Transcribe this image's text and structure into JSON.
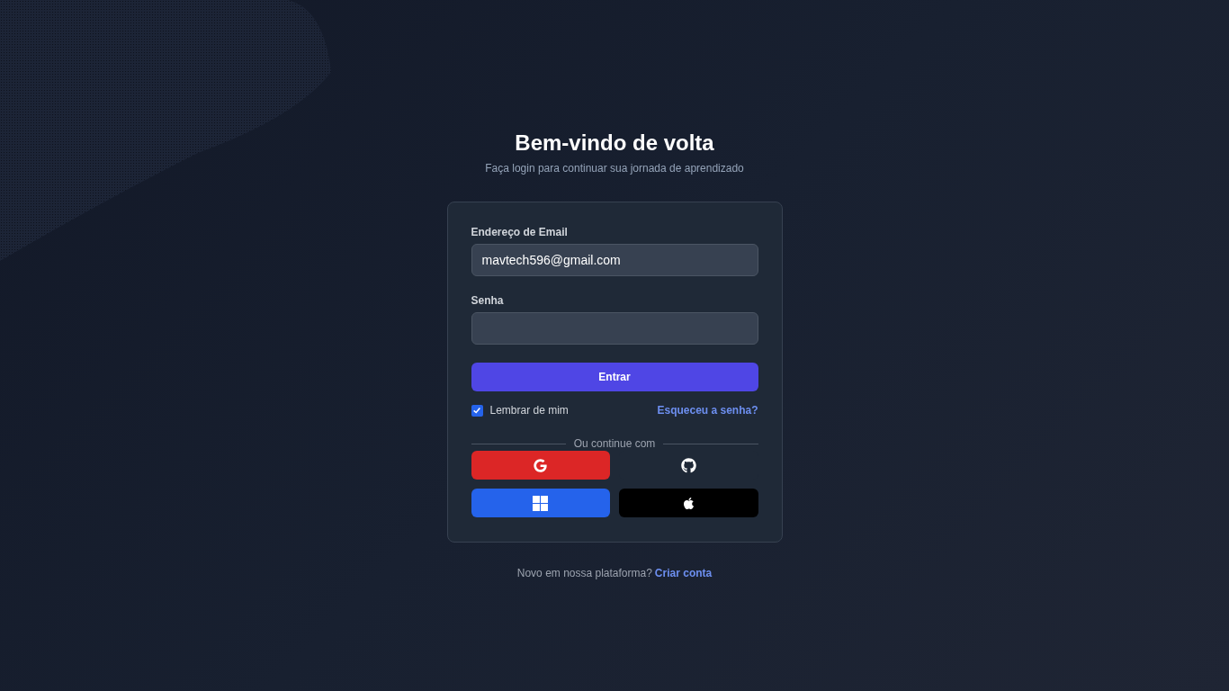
{
  "header": {
    "title": "Bem-vindo de volta",
    "subtitle": "Faça login para continuar sua jornada de aprendizado"
  },
  "form": {
    "fields": [
      {
        "label": "Endereço de Email",
        "value": "mavtech596@gmail.com"
      },
      {
        "label": "Senha"
      }
    ],
    "submit": "Entrar",
    "remember": {
      "label": "Lembrar de mim",
      "checked": true
    },
    "forgot_link": "Esqueceu a senha?",
    "divider": "Ou continue com",
    "social_buttons": [
      {
        "kind": "google",
        "color": "#dc2626"
      },
      {
        "kind": "github",
        "color": "#1f2937"
      },
      {
        "kind": "windows",
        "color": "#2563eb"
      },
      {
        "kind": "apple",
        "color": "#000000"
      }
    ]
  },
  "footer": {
    "text": "Novo em nossa plataforma?",
    "link": "Criar conta"
  }
}
